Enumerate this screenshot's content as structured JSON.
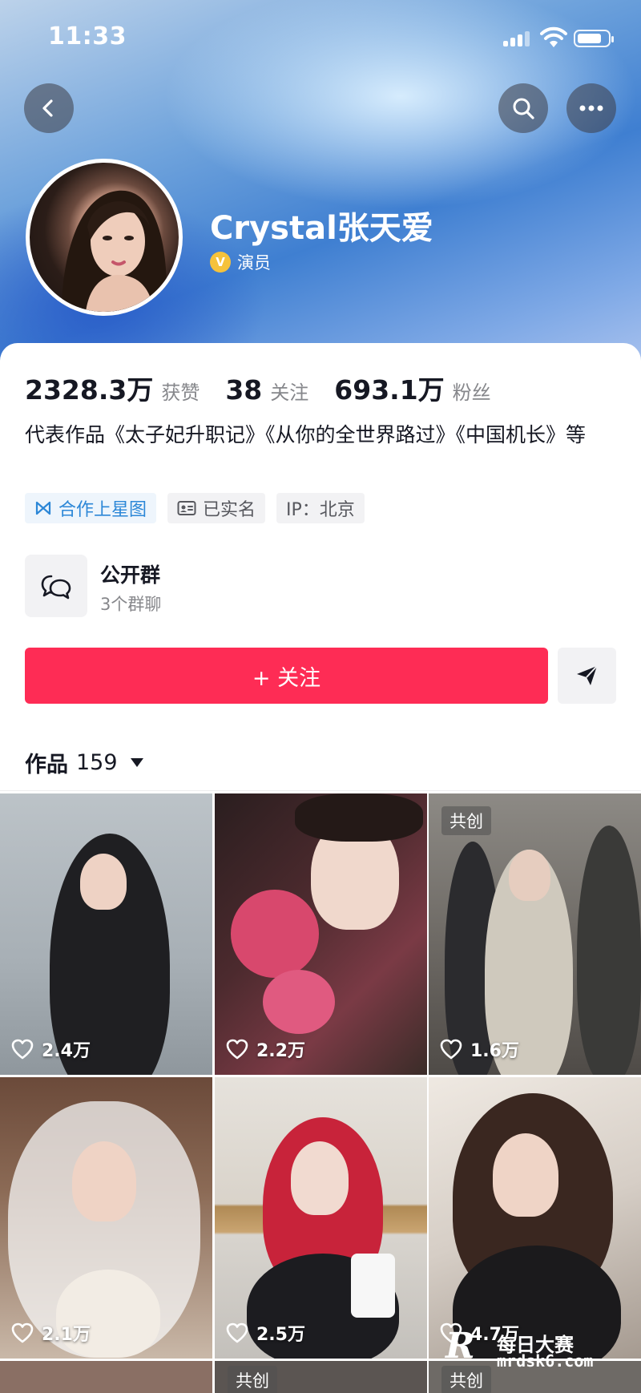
{
  "status_bar": {
    "time": "11:33",
    "battery_level": 0.8
  },
  "header": {
    "back_icon": "chevron-left-icon",
    "search_icon": "search-icon",
    "more_icon": "more-horizontal-icon"
  },
  "profile": {
    "name": "Crystal张天爱",
    "verified_badge": "V",
    "role": "演员",
    "stats": [
      {
        "value": "2328.3万",
        "label": "获赞"
      },
      {
        "value": "38",
        "label": "关注"
      },
      {
        "value": "693.1万",
        "label": "粉丝"
      }
    ],
    "bio": "代表作品《太子妃升职记》《从你的全世界路过》《中国机长》等",
    "tags": [
      {
        "label": "合作上星图",
        "icon": "xingtu-icon"
      },
      {
        "label": "已实名",
        "icon": "id-card-icon"
      },
      {
        "label": "IP：北京",
        "icon": ""
      }
    ]
  },
  "group_chat": {
    "title": "公开群",
    "subtitle": "3个群聊"
  },
  "actions": {
    "follow_label": "+ 关注",
    "share_icon": "send-icon"
  },
  "works": {
    "label": "作品",
    "count": "159"
  },
  "videos": [
    {
      "likes": "2.4万",
      "collab": ""
    },
    {
      "likes": "2.2万",
      "collab": ""
    },
    {
      "likes": "1.6万",
      "collab": "共创"
    },
    {
      "likes": "2.1万",
      "collab": ""
    },
    {
      "likes": "2.5万",
      "collab": ""
    },
    {
      "likes": "4.7万",
      "collab": ""
    }
  ],
  "bottom_row_partial": [
    {
      "collab": ""
    },
    {
      "collab": "共创"
    },
    {
      "collab": "共创"
    }
  ],
  "watermark": {
    "logo": "R",
    "title": "每日大赛",
    "url": "mrdsk6.com"
  },
  "colors": {
    "accent": "#fe2c55",
    "link_blue": "#2c87d7",
    "verified": "#f5c23b"
  }
}
